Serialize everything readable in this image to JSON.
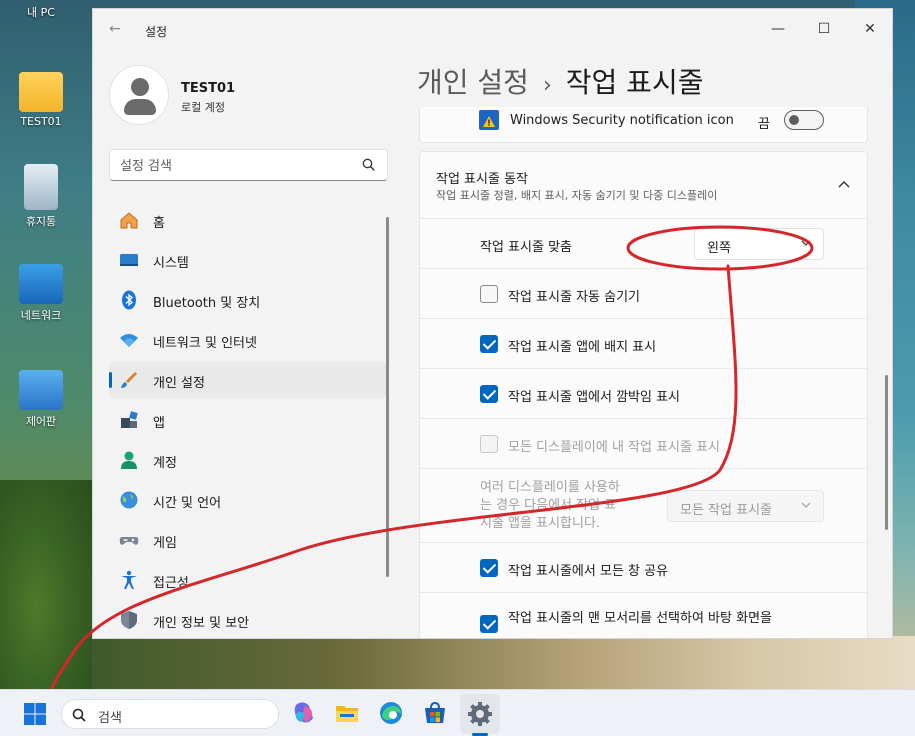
{
  "desktop": {
    "icons": [
      {
        "label": "내 PC"
      },
      {
        "label": "TEST01"
      },
      {
        "label": "휴지통"
      },
      {
        "label": "네트워크"
      },
      {
        "label": "제어판"
      }
    ]
  },
  "window": {
    "title": "설정",
    "controls": {
      "minimize": "—",
      "maximize": "☐",
      "close": "✕"
    }
  },
  "profile": {
    "name": "TEST01",
    "account_type": "로컬 계정"
  },
  "search": {
    "placeholder": "설정 검색"
  },
  "nav": {
    "items": [
      {
        "label": "홈",
        "icon": "home-icon"
      },
      {
        "label": "시스템",
        "icon": "system-icon"
      },
      {
        "label": "Bluetooth 및 장치",
        "icon": "bluetooth-icon"
      },
      {
        "label": "네트워크 및 인터넷",
        "icon": "wifi-icon"
      },
      {
        "label": "개인 설정",
        "icon": "brush-icon",
        "active": true
      },
      {
        "label": "앱",
        "icon": "apps-icon"
      },
      {
        "label": "계정",
        "icon": "account-icon"
      },
      {
        "label": "시간 및 언어",
        "icon": "globe-icon"
      },
      {
        "label": "게임",
        "icon": "gamepad-icon"
      },
      {
        "label": "접근성",
        "icon": "accessibility-icon"
      },
      {
        "label": "개인 정보 및 보안",
        "icon": "shield-icon"
      }
    ]
  },
  "breadcrumb": {
    "parent": "개인 설정",
    "separator": "›",
    "current": "작업 표시줄"
  },
  "content": {
    "security_row": {
      "label": "Windows Security notification icon",
      "state": "끔"
    },
    "behaviors": {
      "title": "작업 표시줄 동작",
      "subtitle": "작업 표시줄 정렬, 배지 표시, 자동 숨기기 및 다중 디스플레이",
      "alignment": {
        "label": "작업 표시줄 맞춤",
        "value": "왼쪽"
      },
      "options": [
        {
          "label": "작업 표시줄 자동 숨기기",
          "checked": false,
          "disabled": false
        },
        {
          "label": "작업 표시줄 앱에 배지 표시",
          "checked": true,
          "disabled": false
        },
        {
          "label": "작업 표시줄 앱에서 깜박임 표시",
          "checked": true,
          "disabled": false
        },
        {
          "label": "모든 디스플레이에 내 작업 표시줄 표시",
          "checked": false,
          "disabled": true
        }
      ],
      "multi_display": {
        "label_lines": [
          "여러 디스플레이를 사용하",
          "는 경우 다음에서 작업 표",
          "시줄 앱을 표시합니다."
        ],
        "value": "모든 작업 표시줄"
      },
      "share_windows": {
        "label": "작업 표시줄에서 모든 창 공유",
        "checked": true
      },
      "corner_desktop": {
        "label": "작업 표시줄의 맨 모서리를 선택하여 바탕 화면을",
        "checked": true
      }
    }
  },
  "taskbar": {
    "search_text": "검색",
    "apps": [
      "copilot-icon",
      "file-explorer-icon",
      "edge-icon",
      "store-icon",
      "settings-icon"
    ]
  },
  "colors": {
    "accent": "#0067c0",
    "annotation": "#d4262b"
  }
}
